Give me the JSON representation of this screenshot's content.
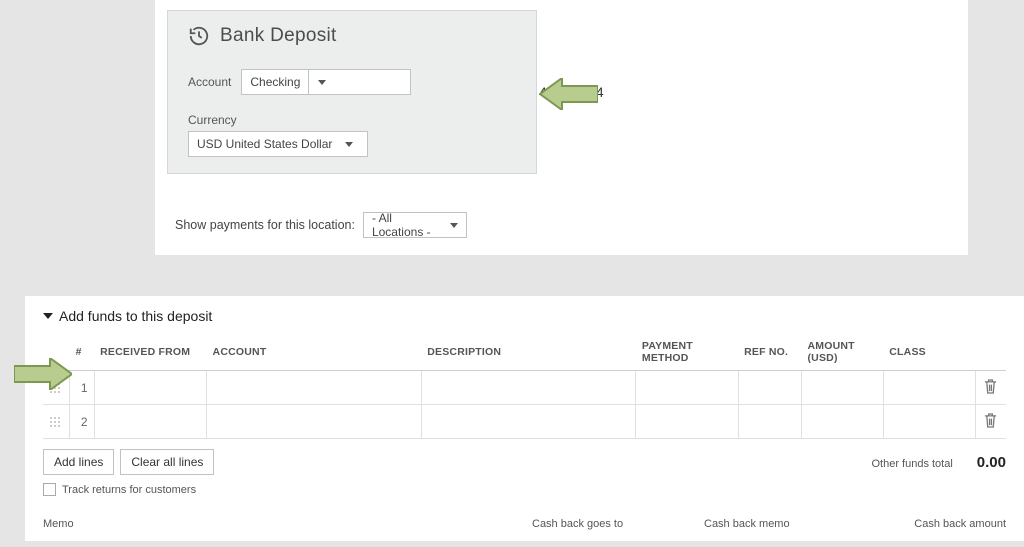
{
  "header": {
    "title": "Bank Deposit",
    "account_label": "Account",
    "account_value": "Checking",
    "balance_display": "42,399.84",
    "currency_label": "Currency",
    "currency_value": "USD United States Dollar"
  },
  "location_filter": {
    "label": "Show payments for this location:",
    "value": "- All Locations -"
  },
  "funds": {
    "section_title": "Add funds to this deposit",
    "columns": {
      "num": "#",
      "received_from": "RECEIVED FROM",
      "account": "ACCOUNT",
      "description": "DESCRIPTION",
      "payment_method": "PAYMENT METHOD",
      "ref_no": "REF NO.",
      "amount": "AMOUNT (USD)",
      "class": "CLASS"
    },
    "rows": [
      {
        "num": "1"
      },
      {
        "num": "2"
      }
    ],
    "buttons": {
      "add_lines": "Add lines",
      "clear_all": "Clear all lines"
    },
    "other_funds_label": "Other funds total",
    "other_funds_total": "0.00",
    "track_returns_label": "Track returns for customers",
    "bottom": {
      "memo": "Memo",
      "cb_goes_to": "Cash back goes to",
      "cb_memo": "Cash back memo",
      "cb_amount": "Cash back amount"
    }
  }
}
